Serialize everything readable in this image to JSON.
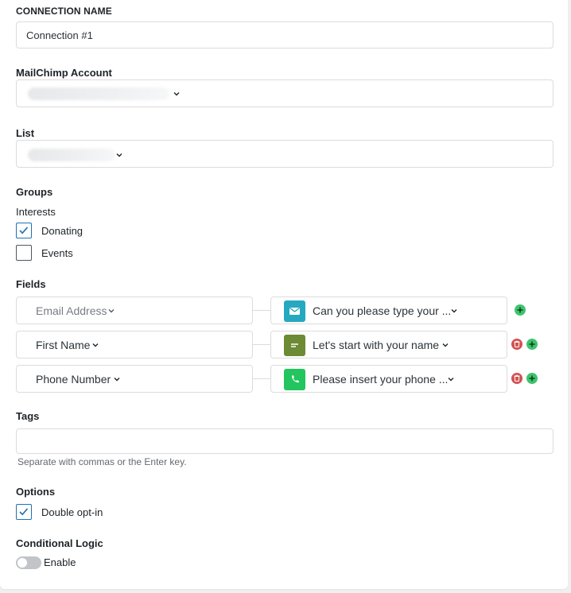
{
  "connection": {
    "label": "CONNECTION NAME",
    "value": "Connection #1"
  },
  "account": {
    "label": "MailChimp Account"
  },
  "list": {
    "label": "List"
  },
  "groups": {
    "label": "Groups",
    "sublabel": "Interests",
    "items": [
      {
        "label": "Donating",
        "checked": true
      },
      {
        "label": "Events",
        "checked": false
      }
    ]
  },
  "fields": {
    "label": "Fields",
    "rows": [
      {
        "left": "Email Address",
        "right": "Can you please type your ...",
        "icon": "email-icon",
        "icon_color": "#26a9c0",
        "deletable": false
      },
      {
        "left": "First Name",
        "right": "Let's start with your name",
        "icon": "short-text-icon",
        "icon_color": "#6d8a34",
        "deletable": true
      },
      {
        "left": "Phone Number",
        "right": "Please insert your phone ...",
        "icon": "phone-icon",
        "icon_color": "#22c55e",
        "deletable": true
      }
    ]
  },
  "tags": {
    "label": "Tags",
    "value": "",
    "hint": "Separate with commas or the Enter key."
  },
  "options": {
    "label": "Options",
    "double_optin_label": "Double opt-in",
    "double_optin_checked": true
  },
  "conditional": {
    "label": "Conditional Logic",
    "toggle_label": "Enable",
    "enabled": false
  },
  "colors": {
    "add": "#3ec46d",
    "delete": "#d35151",
    "check": "#2271b1"
  }
}
